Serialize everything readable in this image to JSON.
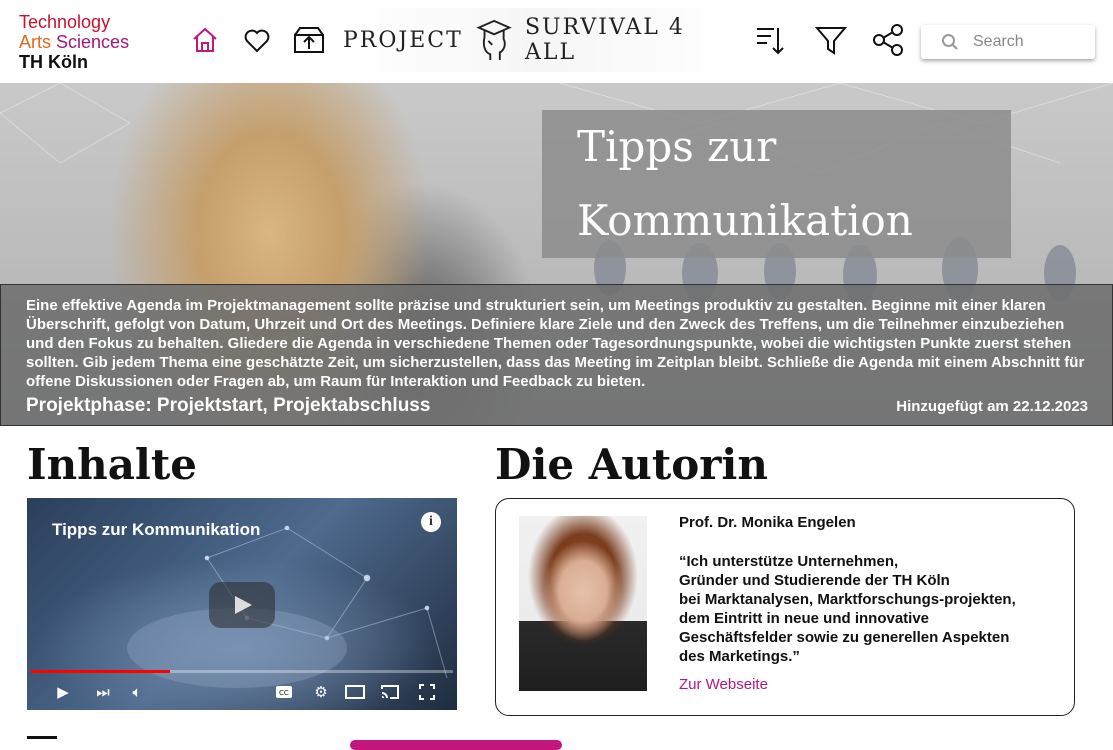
{
  "logo": {
    "line1": "Technology",
    "line2a": "Arts",
    "line2b": "Sciences",
    "line3": "TH Köln"
  },
  "nav": {
    "icons": [
      "home-icon",
      "heart-icon",
      "upload-box-icon"
    ],
    "brand_left": "PROJECT",
    "brand_right": "SURVIVAL 4 ALL",
    "tools": [
      "sort-icon",
      "filter-icon",
      "share-icon"
    ]
  },
  "search": {
    "placeholder": "Search",
    "value": ""
  },
  "hero": {
    "title_line1": "Tipps zur",
    "title_line2": "Kommunikation",
    "description": "Eine effektive Agenda im Projektmanagement sollte präzise und strukturiert sein, um Meetings produktiv zu gestalten. Beginne mit einer klaren Überschrift, gefolgt von Datum, Uhrzeit und Ort des Meetings. Definiere klare Ziele und den Zweck des Treffens, um die Teilnehmer einzubeziehen und den Fokus zu behalten. Gliedere die Agenda in verschiedene Themen oder Tagesordnungspunkte, wobei die wichtigsten Punkte zuerst stehen sollten. Gib jedem Thema eine geschätzte Zeit, um sicherzustellen, dass das Meeting im Zeitplan bleibt. Schließe die Agenda mit einem Abschnitt für offene Diskussionen oder Fragen ab, um Raum für Interaktion und Feedback zu bieten.",
    "phase": "Projektphase: Projektstart, Projektabschluss",
    "added": "Hinzugefügt am 22.12.2023"
  },
  "contents": {
    "heading": "Inhalte",
    "video": {
      "title": "Tipps zur Kommunikation",
      "progress": 0.33
    }
  },
  "author": {
    "heading": "Die Autorin",
    "name": "Prof. Dr. Monika Engelen",
    "quote": "“Ich unterstütze Unternehmen,\nGründer und Studierende der TH Köln\nbei Marktanalysen, Marktforschungs-projekten,\ndem Eintritt in neue und innovative\nGeschäftsfelder sowie zu generellen Aspekten\ndes Marketings.”",
    "link": "Zur Webseite"
  },
  "colors": {
    "accent": "#c2187e",
    "logo_red": "#c8102e",
    "logo_orange": "#e06a1b",
    "logo_purple": "#a3167c"
  }
}
